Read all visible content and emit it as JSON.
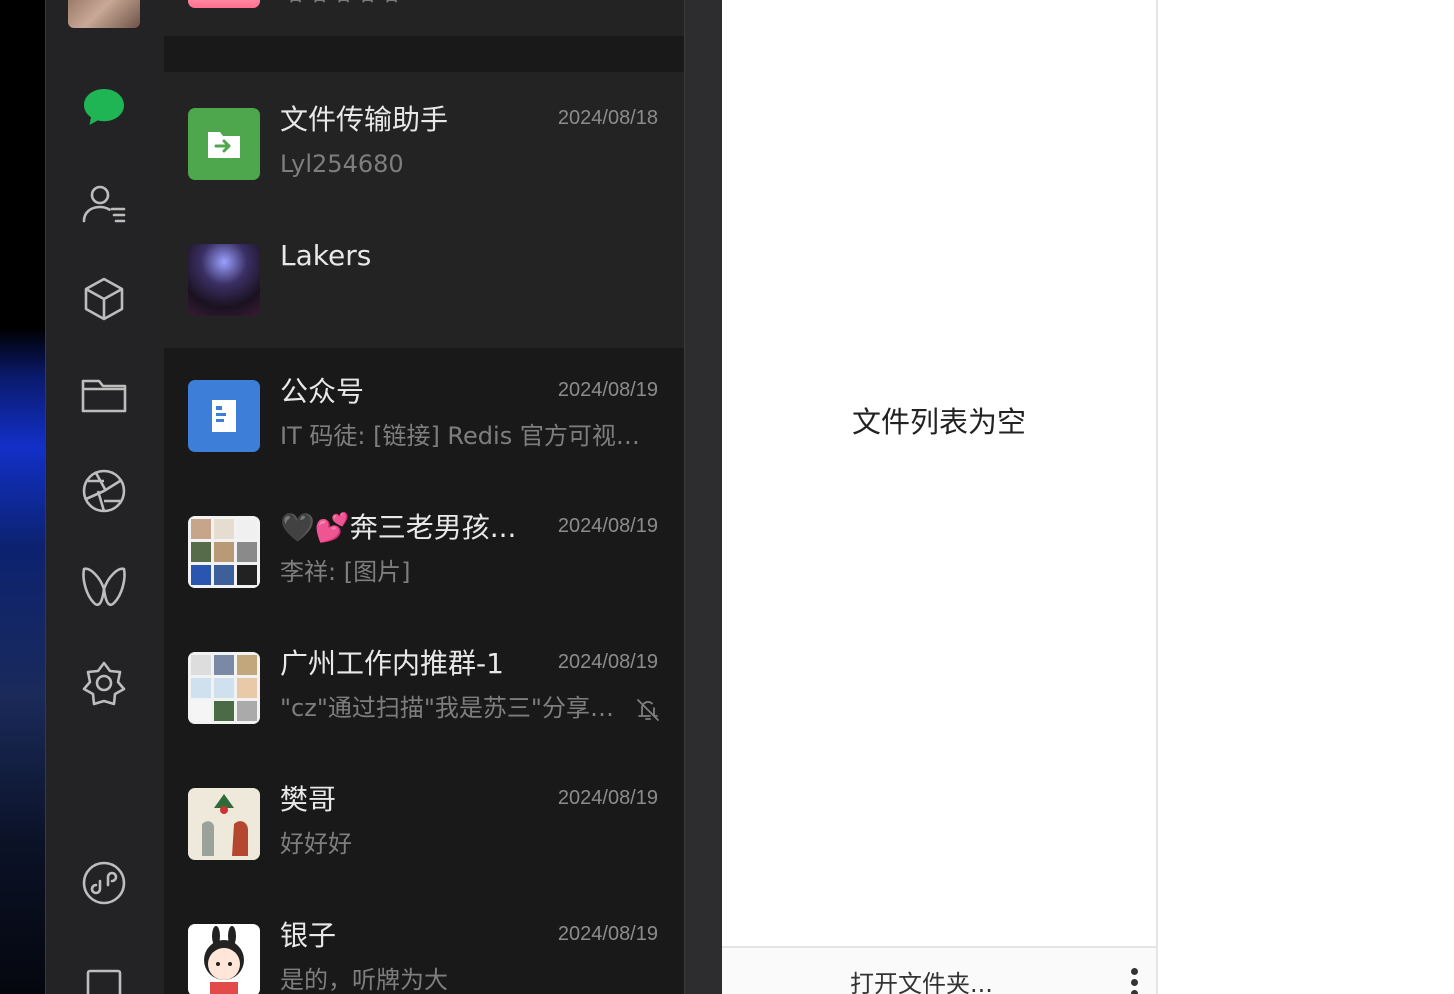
{
  "colors": {
    "accent": "#07c160",
    "rail_bg": "#232325",
    "list_bg": "#191919"
  },
  "rail": {
    "icons": [
      "avatar",
      "chat-icon",
      "contacts-icon",
      "box-icon",
      "folder-icon",
      "aperture-icon",
      "butterfly-icon",
      "star-icon",
      "mini-program-icon",
      "square-icon"
    ]
  },
  "chats": [
    {
      "name": "",
      "date": "",
      "msg": "哈哈哈哈哈",
      "avatar": "cartoon-girl"
    },
    {
      "name": "文件传输助手",
      "date": "2024/08/18",
      "msg": "Lyl254680",
      "avatar": "file-transfer-icon"
    },
    {
      "name": "Lakers",
      "date": "",
      "msg": "",
      "avatar": "concert-photo"
    },
    {
      "name": "公众号",
      "date": "2024/08/19",
      "msg": "IT 码徒: [链接] Redis 官方可视化工具...",
      "avatar": "official-account-icon"
    },
    {
      "name": "🖤💕奔三老男孩...",
      "date": "2024/08/19",
      "msg": "李祥: [图片]",
      "avatar": "group-grid"
    },
    {
      "name": "广州工作内推群-1",
      "date": "2024/08/19",
      "msg": "\"cz\"通过扫描\"我是苏三\"分享的二维码加入群聊",
      "avatar": "group-grid-2",
      "muted": true
    },
    {
      "name": "樊哥",
      "date": "2024/08/19",
      "msg": "好好好",
      "avatar": "illustration"
    },
    {
      "name": "银子",
      "date": "2024/08/19",
      "msg": "是的，听牌为大",
      "avatar": "cartoon-bunny"
    }
  ],
  "file_panel": {
    "empty_text": "文件列表为空",
    "open_folder": "打开文件夹..."
  }
}
